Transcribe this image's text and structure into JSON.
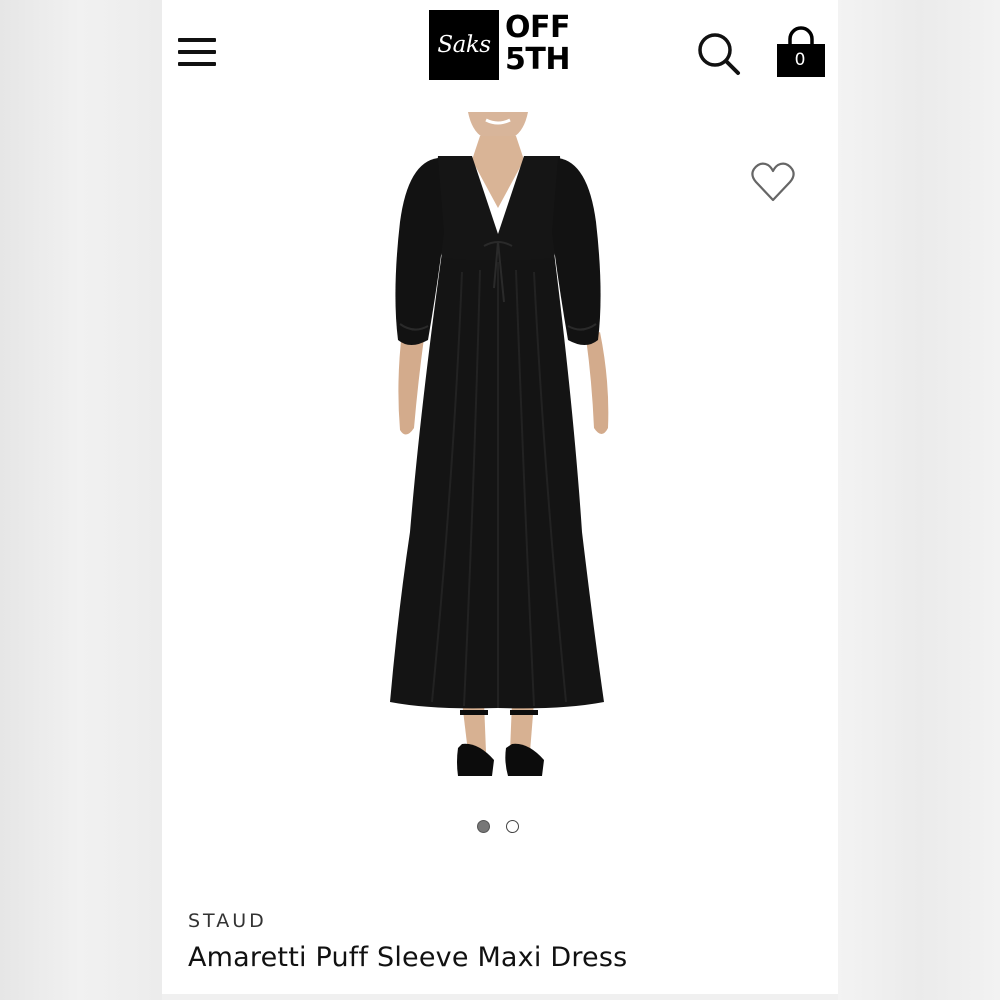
{
  "header": {
    "logo": {
      "monogram": "Saks",
      "line1": "OFF",
      "line2": "5TH"
    },
    "menu_icon": "hamburger-menu-icon",
    "search_icon": "search-icon",
    "bag": {
      "icon": "shopping-bag-icon",
      "count": "0"
    }
  },
  "gallery": {
    "wishlist_icon": "heart-outline-icon",
    "image_count": 2,
    "active_index": 0
  },
  "product": {
    "brand": "STAUD",
    "name": "Amaretti Puff Sleeve Maxi Dress"
  },
  "colors": {
    "brand_black": "#000000",
    "dress": "#141414",
    "background": "#ffffff"
  }
}
